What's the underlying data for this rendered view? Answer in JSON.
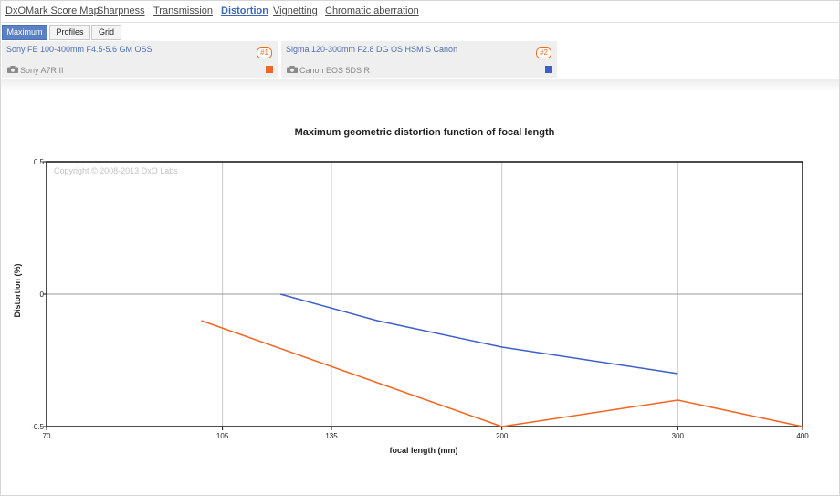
{
  "nav": {
    "items": [
      {
        "label": "DxOMark Score Map",
        "active": false
      },
      {
        "label": "Sharpness",
        "active": false
      },
      {
        "label": "Transmission",
        "active": false
      },
      {
        "label": "Distortion",
        "active": true
      },
      {
        "label": "Vignetting",
        "active": false
      },
      {
        "label": "Chromatic aberration",
        "active": false
      }
    ]
  },
  "subtabs": [
    {
      "label": "Maximum",
      "active": true
    },
    {
      "label": "Profiles",
      "active": false
    },
    {
      "label": "Grid",
      "active": false
    }
  ],
  "lenses": [
    {
      "name": "Sony FE 100-400mm F4.5-5.6 GM OSS",
      "badge": "#1",
      "camera": "Sony A7R II",
      "color": "#f26522",
      "icon": "camera-icon"
    },
    {
      "name": "Sigma 120-300mm F2.8 DG OS HSM S Canon",
      "badge": "#2",
      "camera": "Canon EOS 5DS R",
      "color": "#3d5fc9",
      "icon": "camera-icon"
    }
  ],
  "chart_data": {
    "type": "line",
    "title": "Maximum geometric distortion function of focal length",
    "xlabel": "focal length (mm)",
    "ylabel": "Distortion (%)",
    "x_ticks": [
      70,
      105,
      135,
      200,
      300,
      400
    ],
    "y_ticks": [
      0.5,
      0,
      -0.5
    ],
    "xlim": [
      70,
      400
    ],
    "ylim": [
      -0.5,
      0.5
    ],
    "x_scale": "log",
    "grid": true,
    "watermark": "Copyright © 2008-2013 DxO Labs",
    "series": [
      {
        "name": "Sony FE 100-400mm F4.5-5.6 GM OSS",
        "color": "#f26522",
        "x": [
          100,
          200,
          300,
          400
        ],
        "y": [
          -0.1,
          -0.5,
          -0.4,
          -0.5
        ]
      },
      {
        "name": "Sigma 120-300mm F2.8 DG OS HSM S Canon",
        "color": "#3d5fc9",
        "x": [
          120,
          150,
          200,
          300
        ],
        "y": [
          0,
          -0.1,
          -0.2,
          -0.3
        ]
      }
    ]
  }
}
